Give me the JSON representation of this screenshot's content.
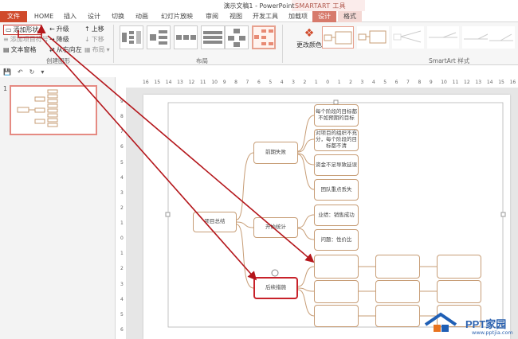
{
  "window": {
    "title": "演示文稿1 - PowerPoint",
    "context_group": "SMARTART 工具"
  },
  "tabs": {
    "file": "文件",
    "home": "HOME",
    "insert": "插入",
    "design": "设计",
    "transitions": "切换",
    "animations": "动画",
    "slideshow": "幻灯片放映",
    "review": "审阅",
    "view": "视图",
    "developer": "开发工具",
    "addin": "加载项",
    "smart_design": "设计",
    "smart_format": "格式"
  },
  "ribbon": {
    "add_shape": "添加形状",
    "add_bullet": "添加项目符号",
    "text_pane": "文本窗格",
    "promote": "升级",
    "demote": "降级",
    "right_to_left": "从右向左",
    "move_up": "上移",
    "move_down": "下移",
    "layout_btn": "布局",
    "group_create": "创建图形",
    "group_layout": "布局",
    "change_colors": "更改颜色",
    "group_styles": "SmartArt 样式"
  },
  "thumbnail": {
    "slide_number": "1"
  },
  "ruler": {
    "h_ticks": [
      "16",
      "15",
      "14",
      "13",
      "12",
      "11",
      "10",
      "9",
      "8",
      "7",
      "6",
      "5",
      "4",
      "3",
      "2",
      "1",
      "0",
      "1",
      "2",
      "3",
      "4",
      "5",
      "6",
      "7",
      "8",
      "9",
      "10",
      "11",
      "12",
      "13",
      "14",
      "15",
      "16"
    ],
    "v_ticks": [
      "9",
      "8",
      "7",
      "6",
      "5",
      "4",
      "3",
      "2",
      "1",
      "0",
      "1",
      "2",
      "3",
      "4",
      "5",
      "6"
    ]
  },
  "diagram": {
    "root": "项目总结",
    "n1": "前期失败",
    "n1_1": "每个阶段的目标都不如预期的目标",
    "n1_2": "对项目的组织不充分，每个阶段的目标都不清",
    "n1_3": "资金不足导致延误",
    "n1_4": "团队重点丢失",
    "n2": "开始统计",
    "n2_1": "业绩：销售成功",
    "n2_2": "问题：性价比",
    "n3": "后续措施"
  },
  "watermark": {
    "brand": "PPT家园",
    "url": "www.pptjia.com"
  },
  "colors": {
    "accent": "#d04a2b",
    "arrow": "#b4161b",
    "connector": "#c79d76"
  }
}
